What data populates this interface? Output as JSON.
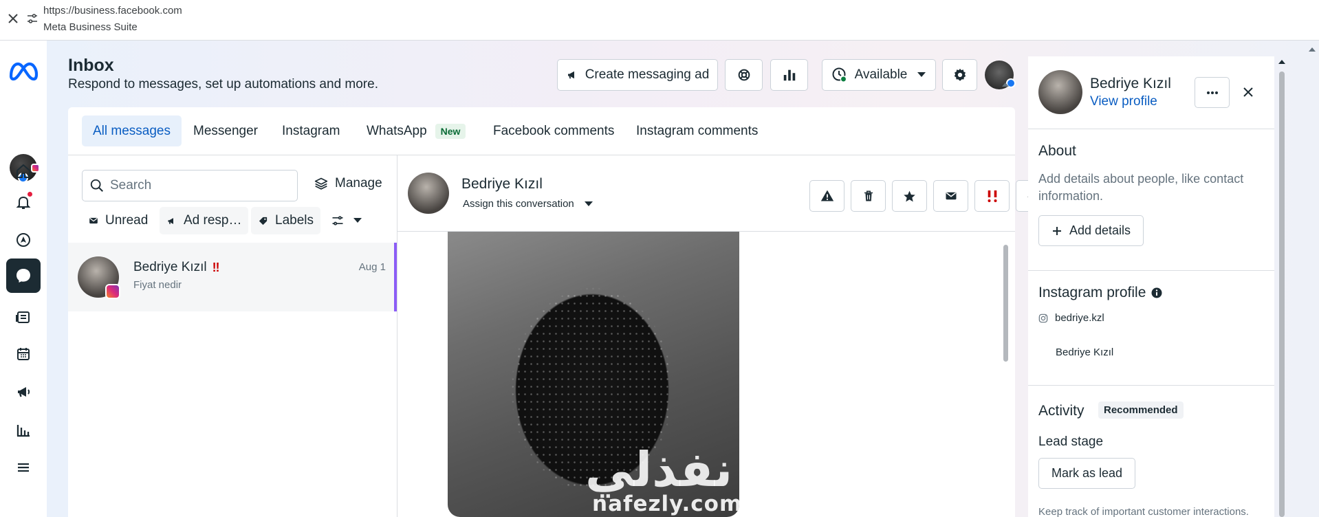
{
  "browser": {
    "url": "https://business.facebook.com",
    "page_title": "Meta Business Suite"
  },
  "leftnav": {
    "items": [
      "home-icon",
      "bell-icon",
      "compass-icon",
      "inbox-icon",
      "content-icon",
      "calendar-icon",
      "megaphone-icon",
      "insights-icon",
      "menu-icon"
    ],
    "active": "inbox-icon"
  },
  "header": {
    "title": "Inbox",
    "subtitle": "Respond to messages, set up automations and more.",
    "create_ad_label": "Create messaging ad",
    "status_label": "Available"
  },
  "tabs": [
    {
      "label": "All messages",
      "active": true
    },
    {
      "label": "Messenger"
    },
    {
      "label": "Instagram"
    },
    {
      "label": "WhatsApp",
      "badge": "New"
    },
    {
      "label": "Facebook comments"
    },
    {
      "label": "Instagram comments"
    }
  ],
  "list": {
    "search_placeholder": "Search",
    "manage_label": "Manage",
    "filters": [
      "Unread",
      "Ad resp…",
      "Labels"
    ],
    "conversations": [
      {
        "name": "Bedriye Kızıl",
        "preview": "Fiyat nedir",
        "date": "Aug 1",
        "urgent": "‼"
      }
    ]
  },
  "chat": {
    "name": "Bedriye Kızıl",
    "assign_label": "Assign this conversation",
    "watermark_arabic": "نفذلي",
    "watermark_latin": "nafezly.com"
  },
  "profile": {
    "name": "Bedriye Kızıl",
    "view_profile": "View profile",
    "about_heading": "About",
    "about_text": "Add details about people, like contact information.",
    "add_details_label": "Add details",
    "instagram_heading": "Instagram profile",
    "ig_username": "bedriye.kzl",
    "ig_name": "Bedriye Kızıl",
    "activity_heading": "Activity",
    "activity_badge": "Recommended",
    "lead_stage_heading": "Lead stage",
    "mark_lead_label": "Mark as lead",
    "footer_text": "Keep track of important customer interactions."
  },
  "colors": {
    "accent": "#0a5dc2",
    "active_tab_bg": "#e7f0fb",
    "selected_border": "#8b5cf6",
    "dark": "#1c2b33"
  }
}
